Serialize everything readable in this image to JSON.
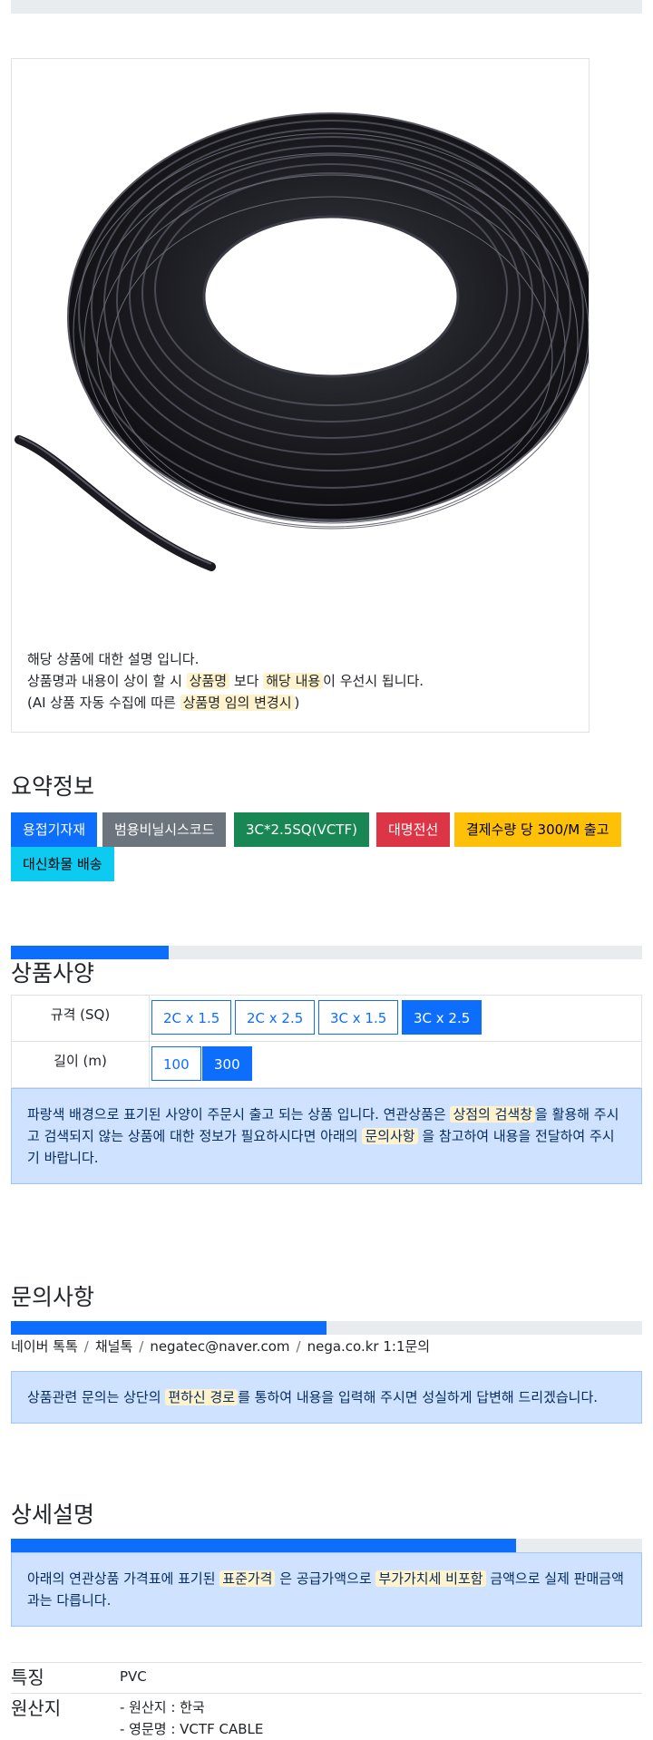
{
  "product": {
    "image_alt": "black cable coil",
    "description": {
      "line1": "해당 상품에 대한 설명 입니다.",
      "line2_pre": "상품명과 내용이 상이 할 시 ",
      "line2_hl1": "상품명",
      "line2_mid": " 보다 ",
      "line2_hl2": "해당 내용",
      "line2_post": "이 우선시 됩니다.",
      "line3_pre": "(AI 상품 자동 수집에 따른 ",
      "line3_hl": "상품명 임의 변경시",
      "line3_post": ")"
    }
  },
  "summary": {
    "title": "요약정보",
    "badges": [
      {
        "label": "용접기자재",
        "color": "#0d6efd",
        "text_color": "#ffffff"
      },
      {
        "label": "범용비닐시스코드",
        "color": "#6c757d",
        "text_color": "#ffffff"
      },
      {
        "label": "3C*2.5SQ(VCTF)",
        "color": "#198754",
        "text_color": "#ffffff"
      },
      {
        "label": "대명전선",
        "color": "#dc3545",
        "text_color": "#ffffff"
      },
      {
        "label": "결제수량 당 300/M 출고",
        "color": "#ffc107",
        "text_color": "#000000"
      },
      {
        "label": "대신화물 배송",
        "color": "#0dcaf0",
        "text_color": "#000000"
      }
    ]
  },
  "spec": {
    "progress": 0.25,
    "title": "상품사양",
    "rows": [
      {
        "label": "규격 (SQ)",
        "options": [
          "2C x 1.5",
          "2C x 2.5",
          "3C x 1.5",
          "3C x 2.5"
        ],
        "selected": 3
      },
      {
        "label": "길이 (m)",
        "options": [
          "100",
          "300"
        ],
        "selected": 1
      }
    ],
    "notice": {
      "pre": "파랑색 배경으로 표기된 사양이 주문시 출고 되는 상품 입니다. 연관상품은 ",
      "hl1": "상점의 검색창",
      "mid1": "을 활용해 주시고 검색되지 않는 상품에 대한 정보가 필요하시다면 아래의 ",
      "hl2": "문의사항",
      "post": " 을 참고하여 내용을 전달하여 주시기 바랍니다."
    }
  },
  "inquiry": {
    "title": "문의사항",
    "progress": 0.5,
    "channels": [
      "네이버 톡톡",
      "채널톡",
      "negatec@naver.com",
      "nega.co.kr 1:1문의"
    ],
    "separator": "/",
    "notice": {
      "pre": "상품관련 문의는 상단의 ",
      "hl": "편하신 경로",
      "post": "를 통하여 내용을 입력해 주시면 성실하게 답변해 드리겠습니다."
    }
  },
  "detail": {
    "title": "상세설명",
    "progress": 0.8,
    "notice": {
      "pre": "아래의 연관상품 가격표에 표기된 ",
      "hl1": "표준가격",
      "mid": " 은 공급가액으로 ",
      "hl2": "부가가치세 비포함",
      "post": " 금액으로 실제 판매금액과는 다릅니다."
    },
    "rows": [
      {
        "key": "특징",
        "values": [
          "PVC"
        ]
      },
      {
        "key": "원산지",
        "values": [
          "- 원산지 : 한국",
          "- 영문명 : VCTF CABLE"
        ]
      }
    ]
  },
  "colors": {
    "primary": "#0d6efd",
    "alert_bg": "#cfe2ff",
    "highlight": "#fff3cd"
  }
}
